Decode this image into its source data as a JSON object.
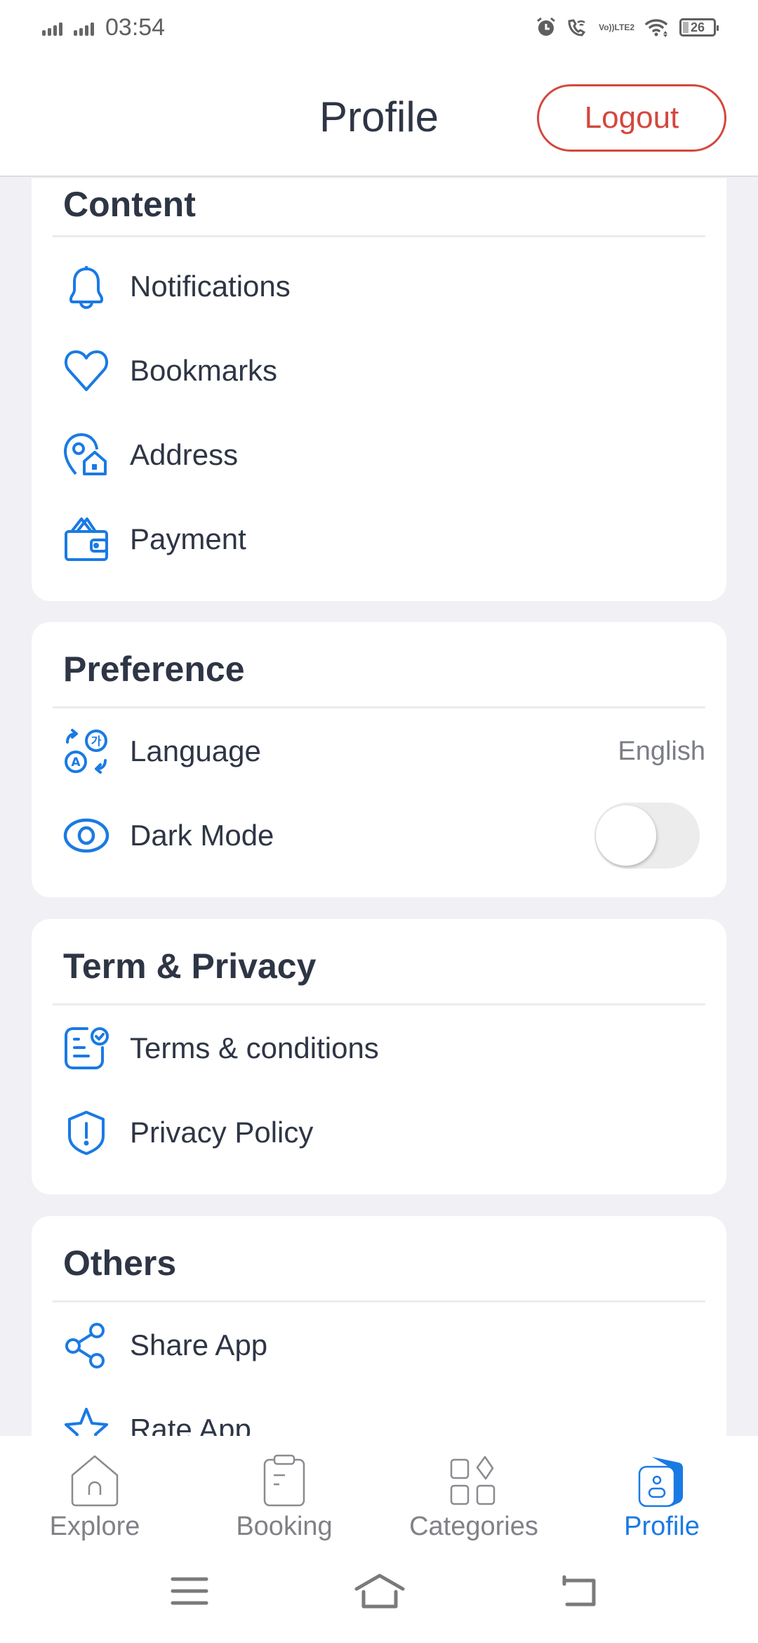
{
  "status_bar": {
    "time": "03:54",
    "battery_level": "26",
    "network_label_top": "Vo))",
    "network_label_bottom": "LTE2",
    "icons": [
      "signal-icon",
      "signal-icon",
      "alarm-icon",
      "wifi-calling-icon",
      "volte-icon",
      "wifi-icon",
      "battery-icon"
    ]
  },
  "header": {
    "title": "Profile",
    "logout_label": "Logout"
  },
  "colors": {
    "accent": "#1a7ae3",
    "logout": "#d4473d",
    "text": "#2e3545",
    "muted": "#7b7e86",
    "background": "#f1f1f5"
  },
  "sections": [
    {
      "title": "Content",
      "items": [
        {
          "label": "Notifications",
          "icon": "bell-icon"
        },
        {
          "label": "Bookmarks",
          "icon": "heart-icon"
        },
        {
          "label": "Address",
          "icon": "location-home-icon"
        },
        {
          "label": "Payment",
          "icon": "wallet-icon"
        }
      ]
    },
    {
      "title": "Preference",
      "items": [
        {
          "label": "Language",
          "icon": "translate-icon",
          "value": "English"
        },
        {
          "label": "Dark Mode",
          "icon": "eye-icon",
          "toggle": false
        }
      ]
    },
    {
      "title": "Term & Privacy",
      "items": [
        {
          "label": "Terms & conditions",
          "icon": "document-check-icon"
        },
        {
          "label": "Privacy Policy",
          "icon": "shield-alert-icon"
        }
      ]
    },
    {
      "title": "Others",
      "items": [
        {
          "label": "Share App",
          "icon": "share-icon"
        },
        {
          "label": "Rate App",
          "icon": "star-icon"
        }
      ]
    }
  ],
  "bottom_nav": {
    "items": [
      {
        "label": "Explore",
        "icon": "home-icon",
        "active": false
      },
      {
        "label": "Booking",
        "icon": "clipboard-icon",
        "active": false
      },
      {
        "label": "Categories",
        "icon": "categories-icon",
        "active": false
      },
      {
        "label": "Profile",
        "icon": "profile-icon",
        "active": true
      }
    ]
  },
  "system_nav": {
    "items": [
      "menu-icon",
      "home-icon",
      "back-icon"
    ]
  }
}
